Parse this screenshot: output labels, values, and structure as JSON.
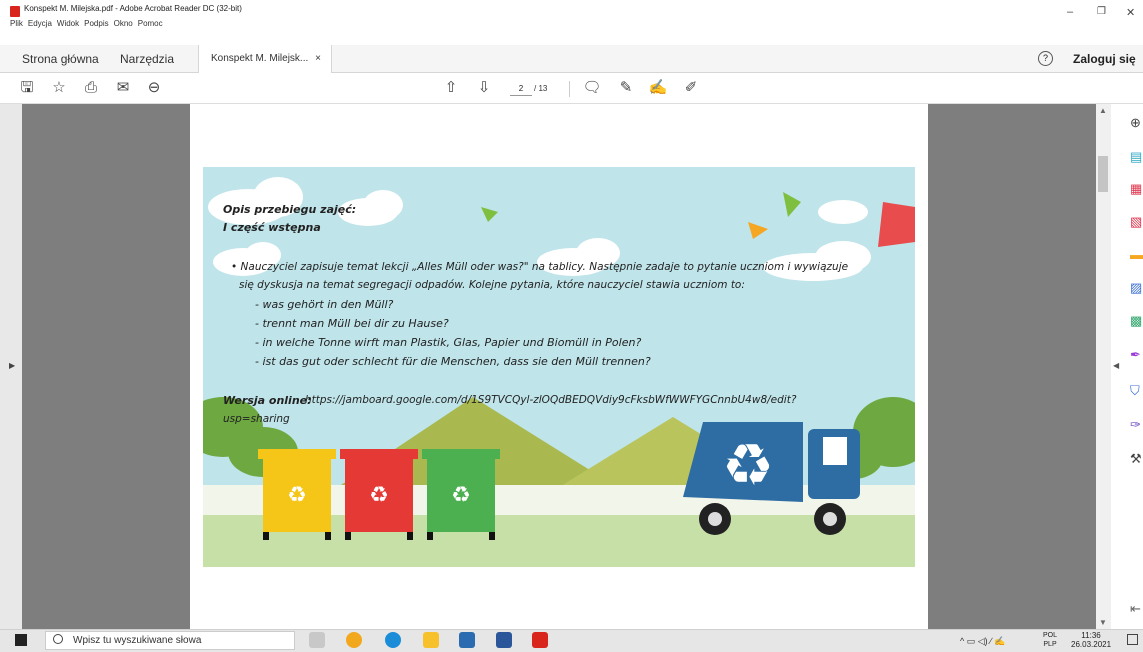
{
  "window": {
    "title": "Konspekt M. Milejska.pdf - Adobe Acrobat Reader DC (32-bit)",
    "menu": [
      "Plik",
      "Edycja",
      "Widok",
      "Podpis",
      "Okno",
      "Pomoc"
    ]
  },
  "tabs": {
    "home": "Strona główna",
    "tools": "Narzędzia",
    "doc": "Konspekt M. Milejsk...",
    "close": "×",
    "signin": "Zaloguj się",
    "help": "?"
  },
  "toolbar": {
    "page_current": "2",
    "page_total": "/ 13"
  },
  "slide": {
    "heading1": "Opis przebiegu zajęć:",
    "heading2": "I część wstępna",
    "bullet_line1": "• Nauczyciel zapisuje temat lekcji „Alles Müll oder was?\" na tablicy. Następnie zadaje to pytanie uczniom i wywiązuje",
    "bullet_line2": "się dyskusja na temat segregacji odpadów. Kolejne pytania, które nauczyciel stawia uczniom to:",
    "questions": [
      "- was gehört in den Müll?",
      "- trennt man Müll bei dir zu Hause?",
      "- in welche Tonne wirft man Plastik, Glas, Papier und Biomüll in Polen?",
      "- ist das gut oder schlecht für die Menschen, dass sie den Müll trennen?"
    ],
    "online_label": "Wersja online:",
    "online_url_line1": "https://jamboard.google.com/d/1S9TVCQyl-zlOQdBEDQVdiy9cFksbWfWWFYGCnnbU4w8/edit?",
    "online_url_line2": "usp=sharing"
  },
  "taskbar": {
    "search_placeholder": "Wpisz tu wyszukiwane słowa",
    "lang_top": "POL",
    "lang_bottom": "PLP",
    "time": "11:36",
    "date": "26.03.2021"
  },
  "colors": {
    "slide_bg": "#bfe4ea",
    "bin_yellow": "#f5c518",
    "bin_red": "#e53935",
    "bin_green": "#4caf50",
    "truck_blue": "#2e6da4"
  }
}
